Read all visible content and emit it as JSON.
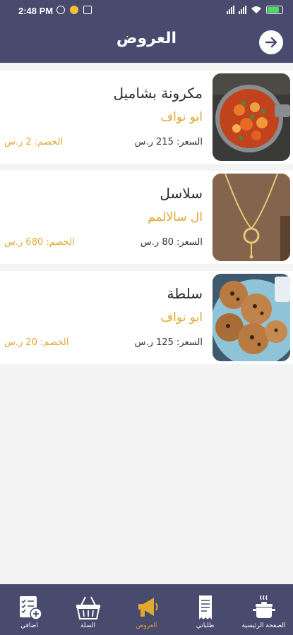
{
  "status": {
    "time": "2:48 PM",
    "battery_level": 0.8
  },
  "header": {
    "title": "العروض",
    "back_icon": "arrow-right-icon"
  },
  "offers": [
    {
      "title": "مكرونة بشاميل",
      "vendor": "ابو نواف",
      "price": "السعر: 215 ر.س",
      "discount": "الخصم: 2 ر.س",
      "image": "pasta-dish-photo"
    },
    {
      "title": "سلاسل",
      "vendor": "ال سالالمم",
      "price": "السعر: 80 ر.س",
      "discount": "الخصم: 680 ر.س",
      "image": "necklace-photo"
    },
    {
      "title": "سلطة",
      "vendor": "ابو نواف",
      "price": "السعر: 125 ر.س",
      "discount": "الخصم: 20 ر.س",
      "image": "cookies-photo"
    }
  ],
  "bottom_nav": [
    {
      "label": "الصفحة الرئيسية",
      "icon": "cooking-pot-icon",
      "active": false
    },
    {
      "label": "طلباتي",
      "icon": "receipt-icon",
      "active": false
    },
    {
      "label": "العروض",
      "icon": "megaphone-icon",
      "active": true
    },
    {
      "label": "السلة",
      "icon": "basket-icon",
      "active": false
    },
    {
      "label": "اضافي",
      "icon": "checklist-add-icon",
      "active": false
    }
  ],
  "colors": {
    "primary": "#484a6e",
    "accent": "#e0a830",
    "background": "#f4f4f4"
  }
}
